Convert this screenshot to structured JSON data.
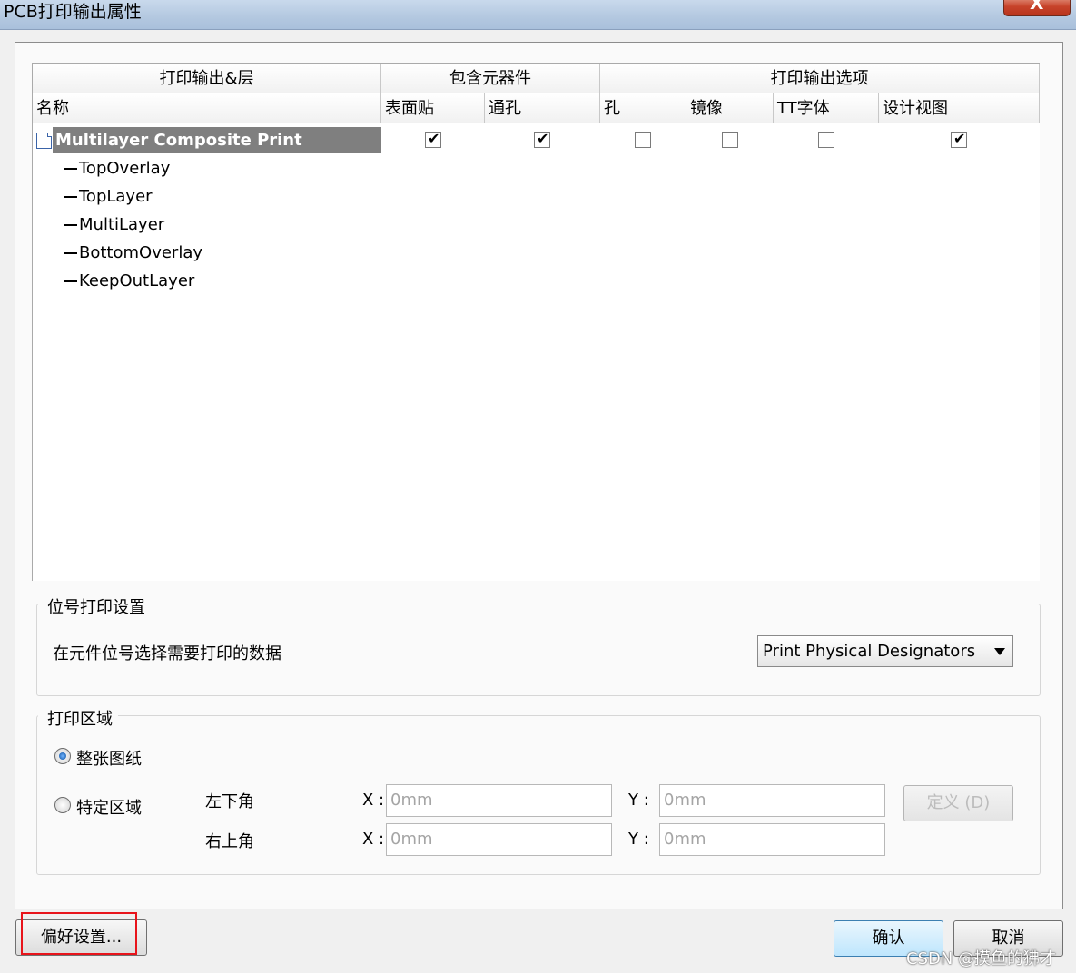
{
  "window": {
    "title": "PCB打印输出属性",
    "close_glyph": "X"
  },
  "grid": {
    "group_headers": [
      "打印输出&层",
      "包含元器件",
      "打印输出选项"
    ],
    "column_headers": [
      "名称",
      "表面贴",
      "通孔",
      "孔",
      "镜像",
      "TT字体",
      "设计视图"
    ],
    "main_row": {
      "label": "Multilayer Composite Print",
      "checks": [
        true,
        true,
        false,
        false,
        false,
        true
      ]
    },
    "layers": [
      "TopOverlay",
      "TopLayer",
      "MultiLayer",
      "BottomOverlay",
      "KeepOutLayer"
    ]
  },
  "designator": {
    "group_title": "位号打印设置",
    "description": "在元件位号选择需要打印的数据",
    "dropdown_value": "Print Physical Designators"
  },
  "print_area": {
    "group_title": "打印区域",
    "option_whole": "整张图纸",
    "option_specific": "特定区域",
    "selected": "整张图纸",
    "lower_left_label": "左下角",
    "upper_right_label": "右上角",
    "x_label": "X :",
    "y_label": "Y :",
    "ll_x": "0mm",
    "ll_y": "0mm",
    "ur_x": "0mm",
    "ur_y": "0mm",
    "define_button": "定义 (D)"
  },
  "footer": {
    "preferences_button": "偏好设置...",
    "ok_button": "确认",
    "cancel_button": "取消"
  },
  "watermark": "CSDN @摸鱼的狒才",
  "colors": {
    "highlight": "#e8141b",
    "selection": "#7f7f7f",
    "radio_dot": "#0b4f9e"
  }
}
